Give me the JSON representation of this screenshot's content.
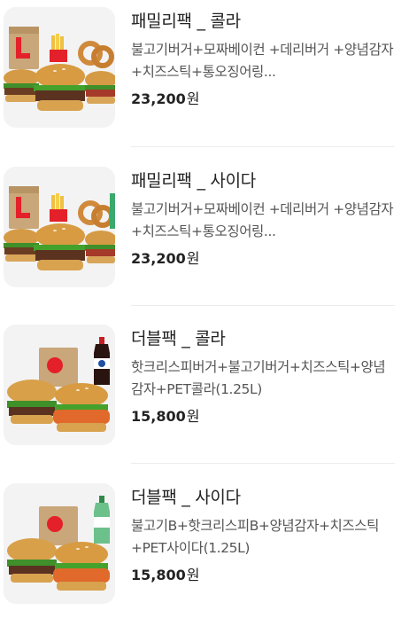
{
  "items": [
    {
      "name": "패밀리팩 _ 콜라",
      "desc": "불고기버거+모짜베이컨 +데리버거 +양념감자 +치즈스틱+통오징어링...",
      "price": "23,200",
      "currency": "원",
      "image_icon": "family-pack-food-icon"
    },
    {
      "name": "패밀리팩 _ 사이다",
      "desc": "불고기버거+모짜베이컨 +데리버거 +양념감자 +치즈스틱+통오징어링...",
      "price": "23,200",
      "currency": "원",
      "image_icon": "family-pack-food-icon"
    },
    {
      "name": "더블팩 _ 콜라",
      "desc": "핫크리스피버거+불고기버거+치즈스틱+양념감자+PET콜라(1.25L)",
      "price": "15,800",
      "currency": "원",
      "image_icon": "double-pack-food-icon"
    },
    {
      "name": "더블팩 _ 사이다",
      "desc": "불고기B+핫크리스피B+양념감자+치즈스틱+PET사이다(1.25L)",
      "price": "15,800",
      "currency": "원",
      "image_icon": "double-pack-food-icon"
    }
  ],
  "colors": {
    "brand_red": "#e4202a",
    "text_primary": "#222222",
    "text_secondary": "#555555",
    "thumb_bg": "#f3f3f3",
    "divider": "#ececec"
  }
}
